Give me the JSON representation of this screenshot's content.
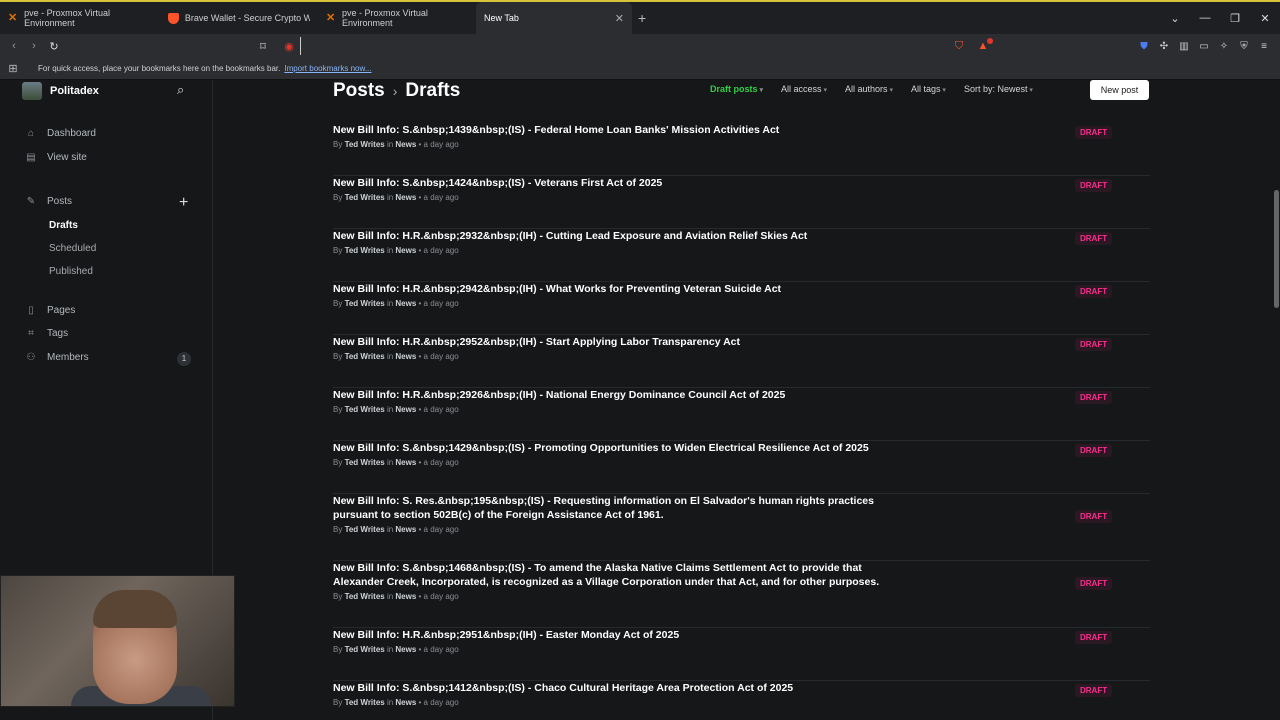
{
  "browser": {
    "tabs": [
      {
        "label": "pve - Proxmox Virtual Environment",
        "icon": "proxmox-icon"
      },
      {
        "label": "Brave Wallet - Secure Crypto Wallet",
        "icon": "brave-icon"
      },
      {
        "label": "pve - Proxmox Virtual Environment",
        "icon": "proxmox-icon"
      },
      {
        "label": "New Tab",
        "icon": "none"
      }
    ],
    "address_value": "",
    "bookmarks_text": "For quick access, place your bookmarks here on the bookmarks bar.",
    "bookmarks_link": "Import bookmarks now...",
    "notification_count": "1"
  },
  "sidebar": {
    "site_name": "Politadex",
    "items": [
      {
        "label": "Dashboard",
        "icon": "house-icon"
      },
      {
        "label": "View site",
        "icon": "layout-icon"
      },
      {
        "label": "Posts",
        "icon": "pen-icon"
      },
      {
        "label": "Pages",
        "icon": "page-icon"
      },
      {
        "label": "Tags",
        "icon": "tag-icon"
      },
      {
        "label": "Members",
        "icon": "members-icon"
      }
    ],
    "post_subitems": [
      "Drafts",
      "Scheduled",
      "Published"
    ],
    "members_count": "1"
  },
  "main": {
    "crumb_root": "Posts",
    "crumb_current": "Drafts",
    "filters": [
      "Draft posts",
      "All access",
      "All authors",
      "All tags",
      "Sort by: Newest"
    ],
    "new_post": "New post",
    "posts": [
      {
        "title": "New Bill Info: S.&nbsp;1439&nbsp;(IS) - Federal Home Loan Banks' Mission Activities Act",
        "author": "Ted Writes",
        "tag": "News",
        "time": "a day ago",
        "status": "DRAFT"
      },
      {
        "title": "New Bill Info: S.&nbsp;1424&nbsp;(IS) - Veterans First Act of 2025",
        "author": "Ted Writes",
        "tag": "News",
        "time": "a day ago",
        "status": "DRAFT"
      },
      {
        "title": "New Bill Info: H.R.&nbsp;2932&nbsp;(IH) - Cutting Lead Exposure and Aviation Relief Skies Act",
        "author": "Ted Writes",
        "tag": "News",
        "time": "a day ago",
        "status": "DRAFT"
      },
      {
        "title": "New Bill Info: H.R.&nbsp;2942&nbsp;(IH) - What Works for Preventing Veteran Suicide Act",
        "author": "Ted Writes",
        "tag": "News",
        "time": "a day ago",
        "status": "DRAFT"
      },
      {
        "title": "New Bill Info: H.R.&nbsp;2952&nbsp;(IH) - Start Applying Labor Transparency Act",
        "author": "Ted Writes",
        "tag": "News",
        "time": "a day ago",
        "status": "DRAFT"
      },
      {
        "title": "New Bill Info: H.R.&nbsp;2926&nbsp;(IH) - National Energy Dominance Council Act of 2025",
        "author": "Ted Writes",
        "tag": "News",
        "time": "a day ago",
        "status": "DRAFT"
      },
      {
        "title": "New Bill Info: S.&nbsp;1429&nbsp;(IS) - Promoting Opportunities to Widen Electrical Resilience Act of 2025",
        "author": "Ted Writes",
        "tag": "News",
        "time": "a day ago",
        "status": "DRAFT"
      },
      {
        "title": "New Bill Info: S. Res.&nbsp;195&nbsp;(IS) - Requesting information on El Salvador's human rights practices pursuant to section 502B(c) of the Foreign Assistance Act of 1961.",
        "author": "Ted Writes",
        "tag": "News",
        "time": "a day ago",
        "status": "DRAFT"
      },
      {
        "title": "New Bill Info: S.&nbsp;1468&nbsp;(IS) - To amend the Alaska Native Claims Settlement Act to provide that Alexander Creek, Incorporated, is recognized as a Village Corporation under that Act, and for other purposes.",
        "author": "Ted Writes",
        "tag": "News",
        "time": "a day ago",
        "status": "DRAFT"
      },
      {
        "title": "New Bill Info: H.R.&nbsp;2951&nbsp;(IH) - Easter Monday Act of 2025",
        "author": "Ted Writes",
        "tag": "News",
        "time": "a day ago",
        "status": "DRAFT"
      },
      {
        "title": "New Bill Info: S.&nbsp;1412&nbsp;(IS) - Chaco Cultural Heritage Area Protection Act of 2025",
        "author": "Ted Writes",
        "tag": "News",
        "time": "a day ago",
        "status": "DRAFT"
      }
    ]
  }
}
